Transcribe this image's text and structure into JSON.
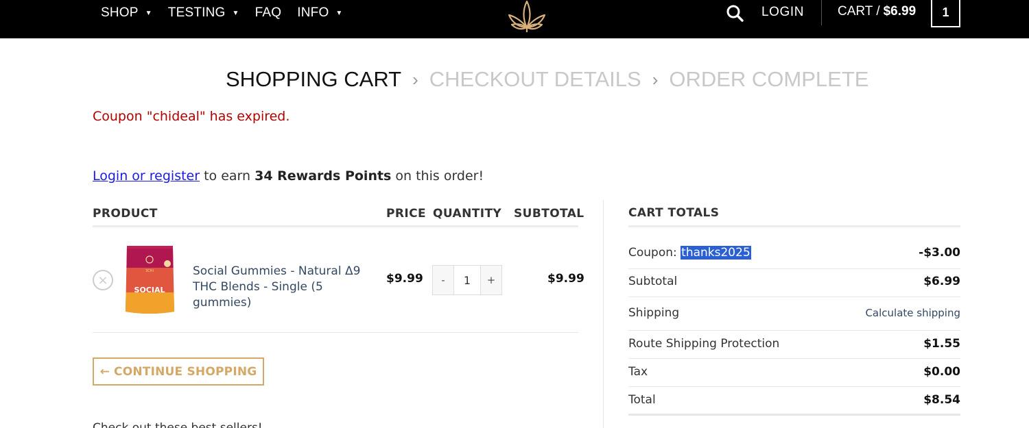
{
  "header": {
    "nav": [
      {
        "label": "SHOP",
        "has_dropdown": true
      },
      {
        "label": "TESTING",
        "has_dropdown": true
      },
      {
        "label": "FAQ",
        "has_dropdown": false
      },
      {
        "label": "INFO",
        "has_dropdown": true
      }
    ],
    "login_label": "LOGIN",
    "cart_label": "CART /",
    "cart_total": "$6.99",
    "cart_count": "1"
  },
  "steps": {
    "current": "SHOPPING CART",
    "next": "CHECKOUT DETAILS",
    "last": "ORDER COMPLETE",
    "separator": "›"
  },
  "notice": {
    "coupon_error": "Coupon \"chideal\" has expired."
  },
  "rewards": {
    "link": "Login or register",
    "pre": "to earn",
    "points": "34 Rewards Points",
    "post": "on this order!"
  },
  "cart_table": {
    "headers": {
      "product": "PRODUCT",
      "price": "PRICE",
      "quantity": "QUANTITY",
      "subtotal": "SUBTOTAL"
    },
    "items": [
      {
        "name": "Social Gummies - Natural Δ9 THC Blends - Single (5 gummies)",
        "image_text": "SOCIAL",
        "image_brand": "3CHI",
        "price": "$9.99",
        "quantity": "1",
        "subtotal": "$9.99"
      }
    ],
    "remove_symbol": "×",
    "qty_minus": "-",
    "qty_plus": "+"
  },
  "continue_button": {
    "arrow": "←",
    "label": "CONTINUE SHOPPING"
  },
  "footer_cut_text": "Check out these best sellers!",
  "totals": {
    "title": "CART TOTALS",
    "coupon_label": "Coupon:",
    "coupon_code": "thanks2025",
    "coupon_amount": "-$3.00",
    "subtotal_label": "Subtotal",
    "subtotal": "$6.99",
    "shipping_label": "Shipping",
    "shipping_action": "Calculate shipping",
    "protection_label": "Route Shipping Protection",
    "protection": "$1.55",
    "tax_label": "Tax",
    "tax": "$0.00",
    "total_label": "Total",
    "total": "$8.54"
  },
  "colors": {
    "header_bg": "#000000",
    "accent_gold": "#d4a866",
    "error_red": "#b20000",
    "link_blue": "#1a1ae6",
    "product_link": "#334862",
    "selection": "#2a5fd6"
  }
}
